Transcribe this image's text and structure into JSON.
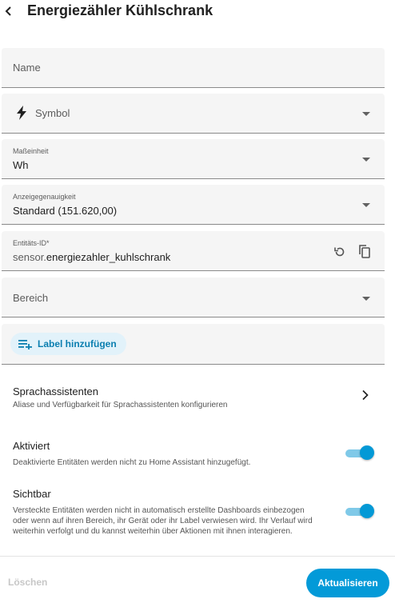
{
  "header": {
    "title": "Energiezähler Kühlschrank"
  },
  "form": {
    "name": {
      "placeholder": "Name"
    },
    "symbol": {
      "placeholder": "Symbol",
      "icon": "flash-icon"
    },
    "unit": {
      "label": "Maßeinheit",
      "value": "Wh"
    },
    "precision": {
      "label": "Anzeigegenauigkeit",
      "value": "Standard (151.620,00)"
    },
    "entity_id": {
      "label": "Entitäts-ID*",
      "prefix": "sensor.",
      "value": "energiezahler_kuhlschrank"
    },
    "area": {
      "placeholder": "Bereich"
    },
    "labels": {
      "add_label": "Label hinzufügen"
    }
  },
  "voice": {
    "title": "Sprachassistenten",
    "description": "Aliase und Verfügbarkeit für Sprachassistenten konfigurieren"
  },
  "enabled": {
    "title": "Aktiviert",
    "description": "Deaktivierte Entitäten werden nicht zu Home Assistant hinzugefügt.",
    "on": true
  },
  "visible": {
    "title": "Sichtbar",
    "description_line1": "Versteckte Entitäten werden nicht in automatisch erstellte Dashboards einbezogen",
    "description_line2": "oder wenn auf ihren Bereich, ihr Gerät oder ihr Label verwiesen wird. Ihr Verlauf wird",
    "description_line3": "weiterhin verfolgt und du kannst weiterhin über Aktionen mit ihnen interagieren.",
    "on": true
  },
  "footer": {
    "delete_label": "Löschen",
    "update_label": "Aktualisieren"
  },
  "colors": {
    "accent": "#039ad8",
    "chip_bg": "#e2f2fa",
    "field_bg": "#f5f5f5"
  }
}
